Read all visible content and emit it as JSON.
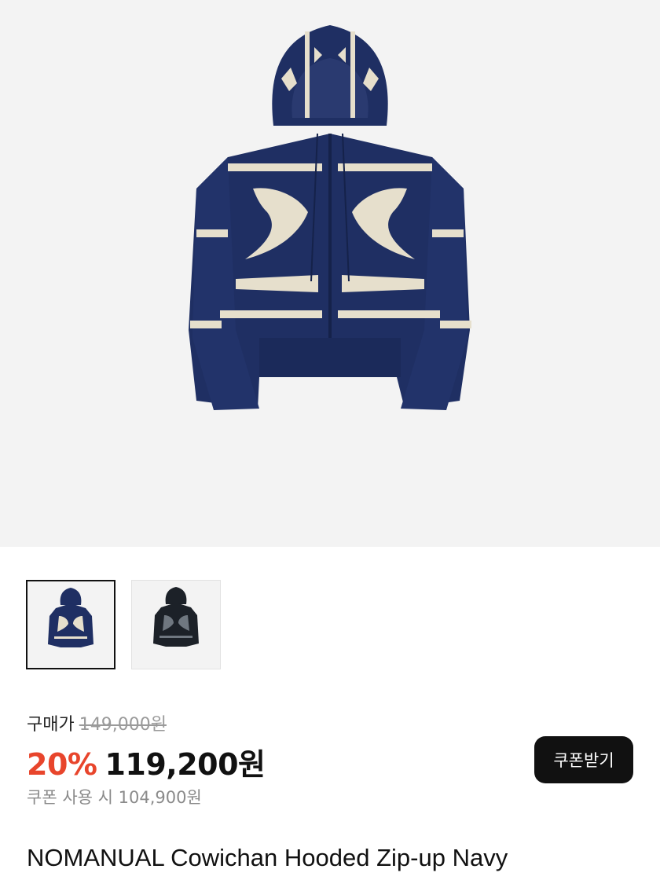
{
  "gallery": {
    "main_image": "product-image-navy-hoodie",
    "thumbnails": [
      {
        "label": "thumbnail-navy",
        "selected": true
      },
      {
        "label": "thumbnail-black",
        "selected": false
      }
    ]
  },
  "price": {
    "label": "구매가",
    "original": "149,000원",
    "discount": "20%",
    "sale": "119,200원",
    "coupon_text": "쿠폰 사용 시 104,900원"
  },
  "coupon_button": {
    "label": "쿠폰받기"
  },
  "product": {
    "title": "NOMANUAL Cowichan Hooded Zip-up Navy"
  },
  "colors": {
    "navy": "#1f2f63",
    "cream": "#e6dfcc",
    "accent": "#e8452c",
    "button": "#111111"
  }
}
